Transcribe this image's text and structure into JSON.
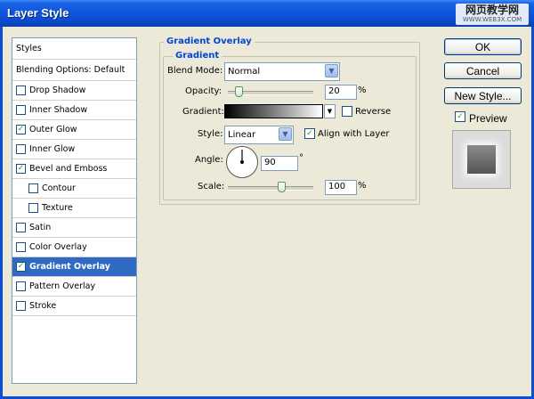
{
  "window": {
    "title": "Layer Style"
  },
  "watermark": {
    "line1": "网页教学网",
    "line2": "WWW.WEB3X.COM"
  },
  "styles_list": {
    "header": "Styles",
    "blending": "Blending Options: Default",
    "items": [
      {
        "label": "Drop Shadow",
        "checked": false
      },
      {
        "label": "Inner Shadow",
        "checked": false
      },
      {
        "label": "Outer Glow",
        "checked": true
      },
      {
        "label": "Inner Glow",
        "checked": false
      },
      {
        "label": "Bevel and Emboss",
        "checked": true
      },
      {
        "label": "Contour",
        "checked": false,
        "sub": true
      },
      {
        "label": "Texture",
        "checked": false,
        "sub": true
      },
      {
        "label": "Satin",
        "checked": false
      },
      {
        "label": "Color Overlay",
        "checked": false
      },
      {
        "label": "Gradient Overlay",
        "checked": true,
        "selected": true
      },
      {
        "label": "Pattern Overlay",
        "checked": false
      },
      {
        "label": "Stroke",
        "checked": false
      }
    ]
  },
  "panel": {
    "title": "Gradient Overlay",
    "group": "Gradient",
    "blend_mode": {
      "label": "Blend Mode:",
      "value": "Normal"
    },
    "opacity": {
      "label": "Opacity:",
      "value": "20",
      "unit": "%",
      "level": 20
    },
    "gradient": {
      "label": "Gradient:",
      "reverse_label": "Reverse",
      "reverse": false
    },
    "style": {
      "label": "Style:",
      "value": "Linear",
      "align_label": "Align with Layer",
      "align": true
    },
    "angle": {
      "label": "Angle:",
      "value": "90",
      "unit": "°"
    },
    "scale": {
      "label": "Scale:",
      "value": "100",
      "unit": "%",
      "level": 100
    }
  },
  "buttons": {
    "ok": "OK",
    "cancel": "Cancel",
    "new_style": "New Style..."
  },
  "preview": {
    "label": "Preview",
    "checked": true
  }
}
